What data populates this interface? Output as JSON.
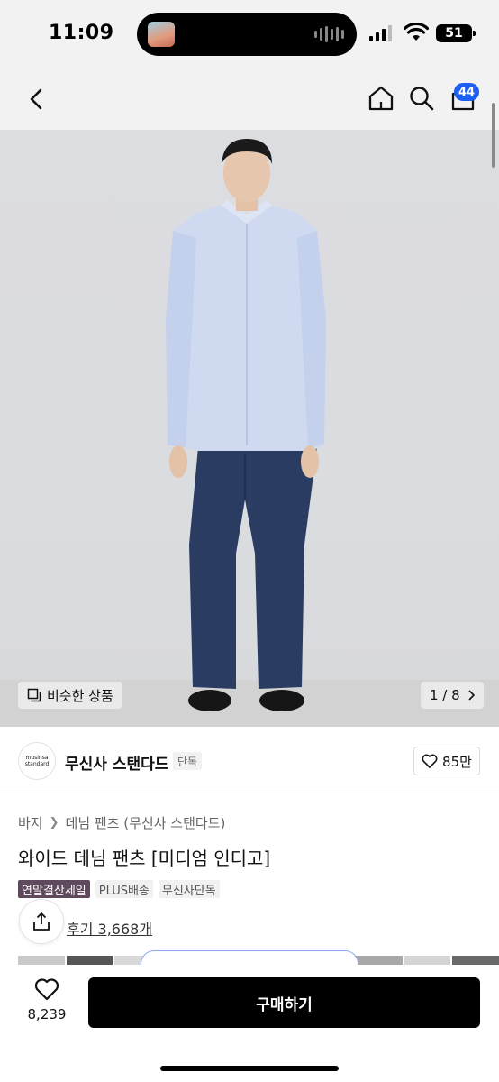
{
  "status_bar": {
    "time": "11:09",
    "battery": "51"
  },
  "header": {
    "cart_count": "44",
    "icons": [
      "back-icon",
      "home-icon",
      "search-icon",
      "cart-icon"
    ]
  },
  "hero": {
    "similar_button": "비슷한 상품",
    "page_indicator": "1 / 8",
    "colors": {
      "shirt": "#cfdaf0",
      "jeans": "#2b3c63",
      "wall": "#dcdde1"
    }
  },
  "brand": {
    "logo_line1": "musinsa",
    "logo_line2": "standard",
    "name": "무신사 스탠다드",
    "exclusive_tag": "단독",
    "likes": "85만"
  },
  "product": {
    "breadcrumb": [
      "바지",
      "데님 팬츠 (무신사 스탠다드)"
    ],
    "title": "와이드 데님 팬츠 [미디엄 인디고]",
    "tags": [
      "연말결산세일",
      "PLUS배송",
      "무신사단독"
    ],
    "review_link": "후기 3,668개"
  },
  "bottom_bar": {
    "wish_count": "8,239",
    "buy_button": "구매하기",
    "accent_color": "#000000"
  }
}
